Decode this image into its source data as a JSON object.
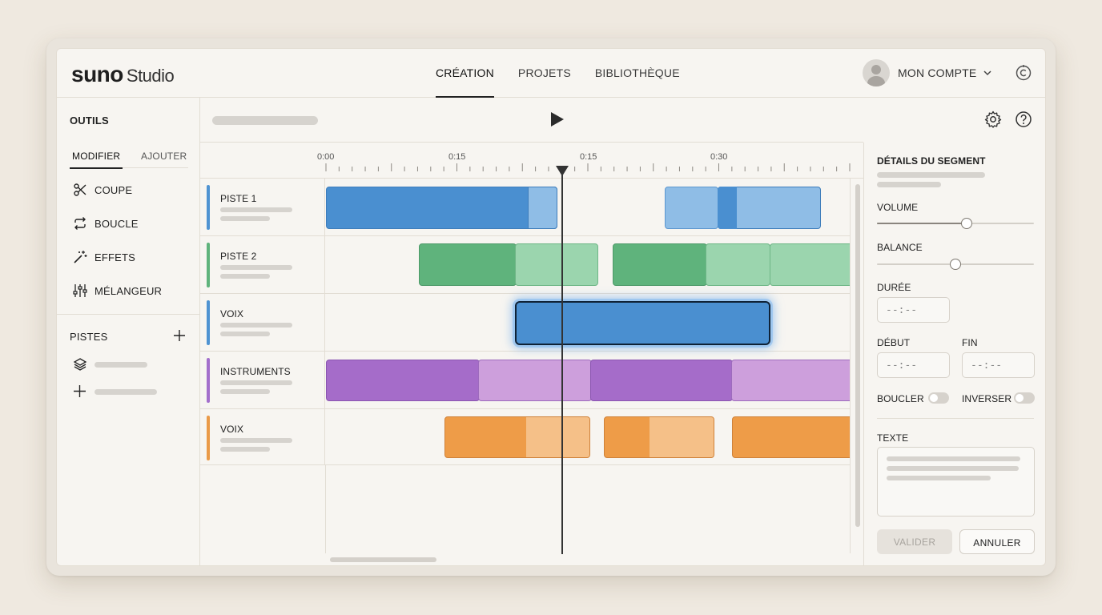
{
  "header": {
    "brand": "suno",
    "product": "Studio",
    "nav": [
      {
        "label": "CRÉATION",
        "active": true
      },
      {
        "label": "PROJETS",
        "active": false
      },
      {
        "label": "BIBLIOTHÈQUE",
        "active": false
      }
    ],
    "account_label": "MON COMPTE"
  },
  "sidebar": {
    "tools_title": "OUTILS",
    "tabs": [
      {
        "label": "MODIFIER",
        "active": true
      },
      {
        "label": "AJOUTER",
        "active": false
      }
    ],
    "tools": [
      {
        "label": "COUPE",
        "icon": "scissors-icon"
      },
      {
        "label": "BOUCLE",
        "icon": "loop-icon"
      },
      {
        "label": "EFFETS",
        "icon": "magic-wand-icon"
      },
      {
        "label": "MÉLANGEUR",
        "icon": "mixer-sliders-icon"
      }
    ],
    "tracks_title": "PISTES"
  },
  "timeline": {
    "ruler_labels": [
      "0:00",
      "0:15",
      "0:15",
      "0:30"
    ],
    "tracks": [
      {
        "name": "PISTE 1",
        "color": "#4f93d2"
      },
      {
        "name": "PISTE 2",
        "color": "#5fb37c"
      },
      {
        "name": "VOIX",
        "color": "#4f93d2"
      },
      {
        "name": "INSTRUMENTS",
        "color": "#a36fcc"
      },
      {
        "name": "VOIX",
        "color": "#ea9a48"
      }
    ]
  },
  "panel": {
    "title": "DÉTAILS DU SEGMENT",
    "volume_label": "VOLUME",
    "volume_level": 0.57,
    "balance_label": "BALANCE",
    "balance_level": 0.5,
    "duration_label": "DURÉE",
    "duration_value": "--:--",
    "start_label": "DÉBUT",
    "start_value": "--:--",
    "end_label": "FIN",
    "end_value": "--:--",
    "loop_label": "BOUCLER",
    "reverse_label": "INVERSER",
    "text_label": "TEXTE",
    "validate_label": "VALIDER",
    "cancel_label": "ANNULER"
  }
}
